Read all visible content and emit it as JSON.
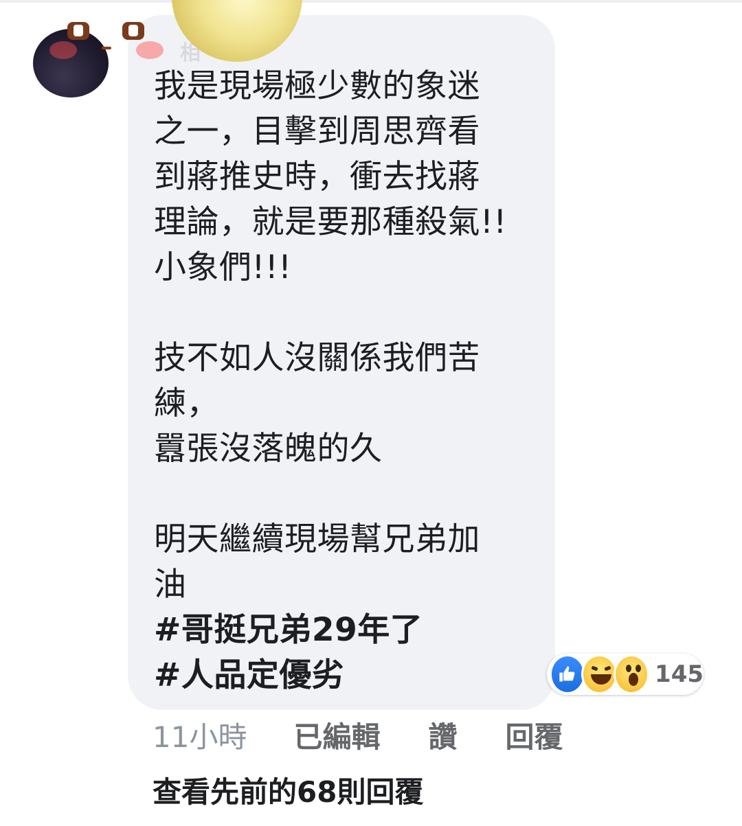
{
  "comment": {
    "author_fragment": "相",
    "lines": [
      "我是現場極少數的象迷",
      "之一，目擊到周思齊看",
      "到蔣推史時，衝去找蔣",
      "理論，就是要那種殺氣!!",
      "小象們!!!",
      "",
      "技不如人沒關係我們苦",
      "練，",
      "囂張沒落魄的久",
      "",
      "明天繼續現場幫兄弟加",
      "油"
    ],
    "hashtags": [
      "#哥挺兄弟29年了",
      "#人品定優劣"
    ]
  },
  "reactions": {
    "icons": [
      "like-icon",
      "haha-icon",
      "wow-icon"
    ],
    "count": "145"
  },
  "actions": {
    "time": "11小時",
    "edited": "已編輯",
    "like": "讚",
    "reply": "回覆"
  },
  "view_previous": "查看先前的68則回覆",
  "colors": {
    "bubble": "#f0f2f5",
    "text": "#1c1e21",
    "meta": "#65676b",
    "like_blue": "#1a6ee0",
    "reaction_yellow": "#f7b928"
  }
}
